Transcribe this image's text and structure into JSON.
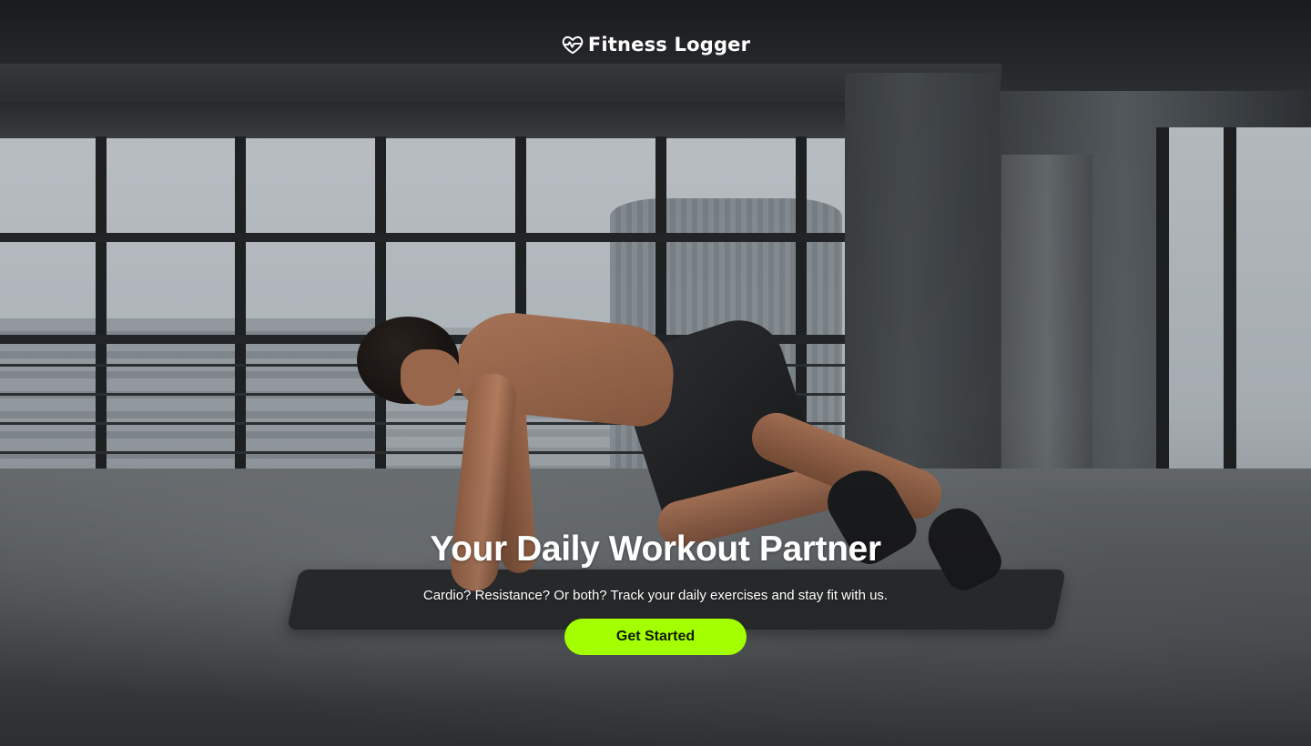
{
  "brand": {
    "name": "Fitness Logger",
    "icon": "heart-pulse-icon"
  },
  "hero": {
    "title": "Your Daily Workout Partner",
    "subtitle": "Cardio? Resistance? Or both? Track your daily exercises and stay fit with us.",
    "cta_label": "Get Started"
  },
  "colors": {
    "accent": "#a4ff00",
    "text": "#ffffff"
  }
}
